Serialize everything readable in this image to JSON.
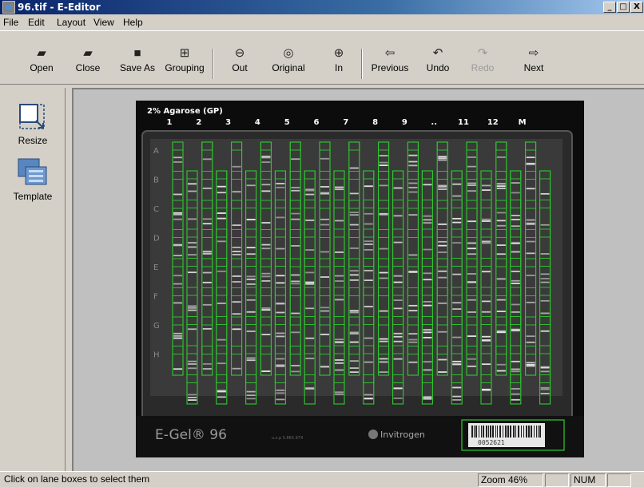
{
  "window": {
    "title": "96.tif - E-Editor",
    "min": "_",
    "max": "□",
    "close": "X"
  },
  "menu": [
    "File",
    "Edit",
    "Layout",
    "View",
    "Help"
  ],
  "toolbar": [
    {
      "label": "Open",
      "icon": "folder-open-icon",
      "enabled": true
    },
    {
      "label": "Close",
      "icon": "folder-close-icon",
      "enabled": true
    },
    {
      "label": "Save As",
      "icon": "floppy-icon",
      "enabled": true
    },
    {
      "label": "Grouping",
      "icon": "grouping-icon",
      "enabled": true
    },
    {
      "label": "Out",
      "icon": "zoom-out-icon",
      "enabled": true
    },
    {
      "label": "Original",
      "icon": "zoom-original-icon",
      "enabled": true
    },
    {
      "label": "In",
      "icon": "zoom-in-icon",
      "enabled": true
    },
    {
      "label": "Previous",
      "icon": "arrow-left-icon",
      "enabled": true
    },
    {
      "label": "Undo",
      "icon": "undo-icon",
      "enabled": true
    },
    {
      "label": "Redo",
      "icon": "redo-icon",
      "enabled": false
    },
    {
      "label": "Next",
      "icon": "arrow-right-icon",
      "enabled": true
    }
  ],
  "sidebar": [
    {
      "label": "Resize",
      "icon": "resize-icon"
    },
    {
      "label": "Template",
      "icon": "template-icon"
    }
  ],
  "gel": {
    "header": "2% Agarose (GP)",
    "columns": [
      "1",
      "2",
      "3",
      "4",
      "5",
      "6",
      "7",
      "8",
      "9",
      "..",
      "11",
      "12",
      "M"
    ],
    "rows": [
      "A",
      "B",
      "C",
      "D",
      "E",
      "F",
      "G",
      "H"
    ],
    "brand": "E-Gel® 96",
    "patent": "u.s.p 5.865.974",
    "maker": "Invitrogen",
    "barcode": "0052621",
    "lane_box_color": "#2ecc2e"
  },
  "status": {
    "message": "Click on lane boxes to select them",
    "zoom": "Zoom 46%",
    "num": "NUM"
  }
}
